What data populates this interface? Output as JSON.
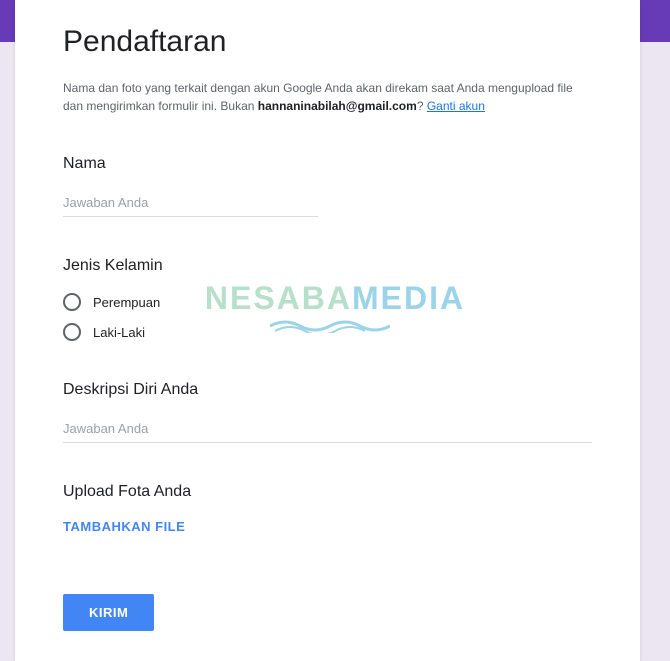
{
  "form": {
    "title": "Pendaftaran",
    "notice_pre": "Nama dan foto yang terkait dengan akun Google Anda akan direkam saat Anda mengupload file dan mengirimkan formulir ini. Bukan ",
    "notice_email": "hannaninabilah@gmail.com",
    "notice_post": "? ",
    "switch_link": "Ganti akun"
  },
  "questions": {
    "nama": {
      "title": "Nama",
      "placeholder": "Jawaban Anda"
    },
    "jenis_kelamin": {
      "title": "Jenis Kelamin",
      "options": [
        "Perempuan",
        "Laki-Laki"
      ]
    },
    "deskripsi": {
      "title": "Deskripsi Diri Anda",
      "placeholder": "Jawaban Anda"
    },
    "upload": {
      "title": "Upload Fota Anda",
      "button": "TAMBAHKAN FILE"
    }
  },
  "submit": "KIRIM",
  "watermark": {
    "part1": "NESABA",
    "part2": "MEDIA"
  },
  "colors": {
    "accent": "#673ab7",
    "primary": "#4285f4",
    "background": "#ece6f2"
  }
}
